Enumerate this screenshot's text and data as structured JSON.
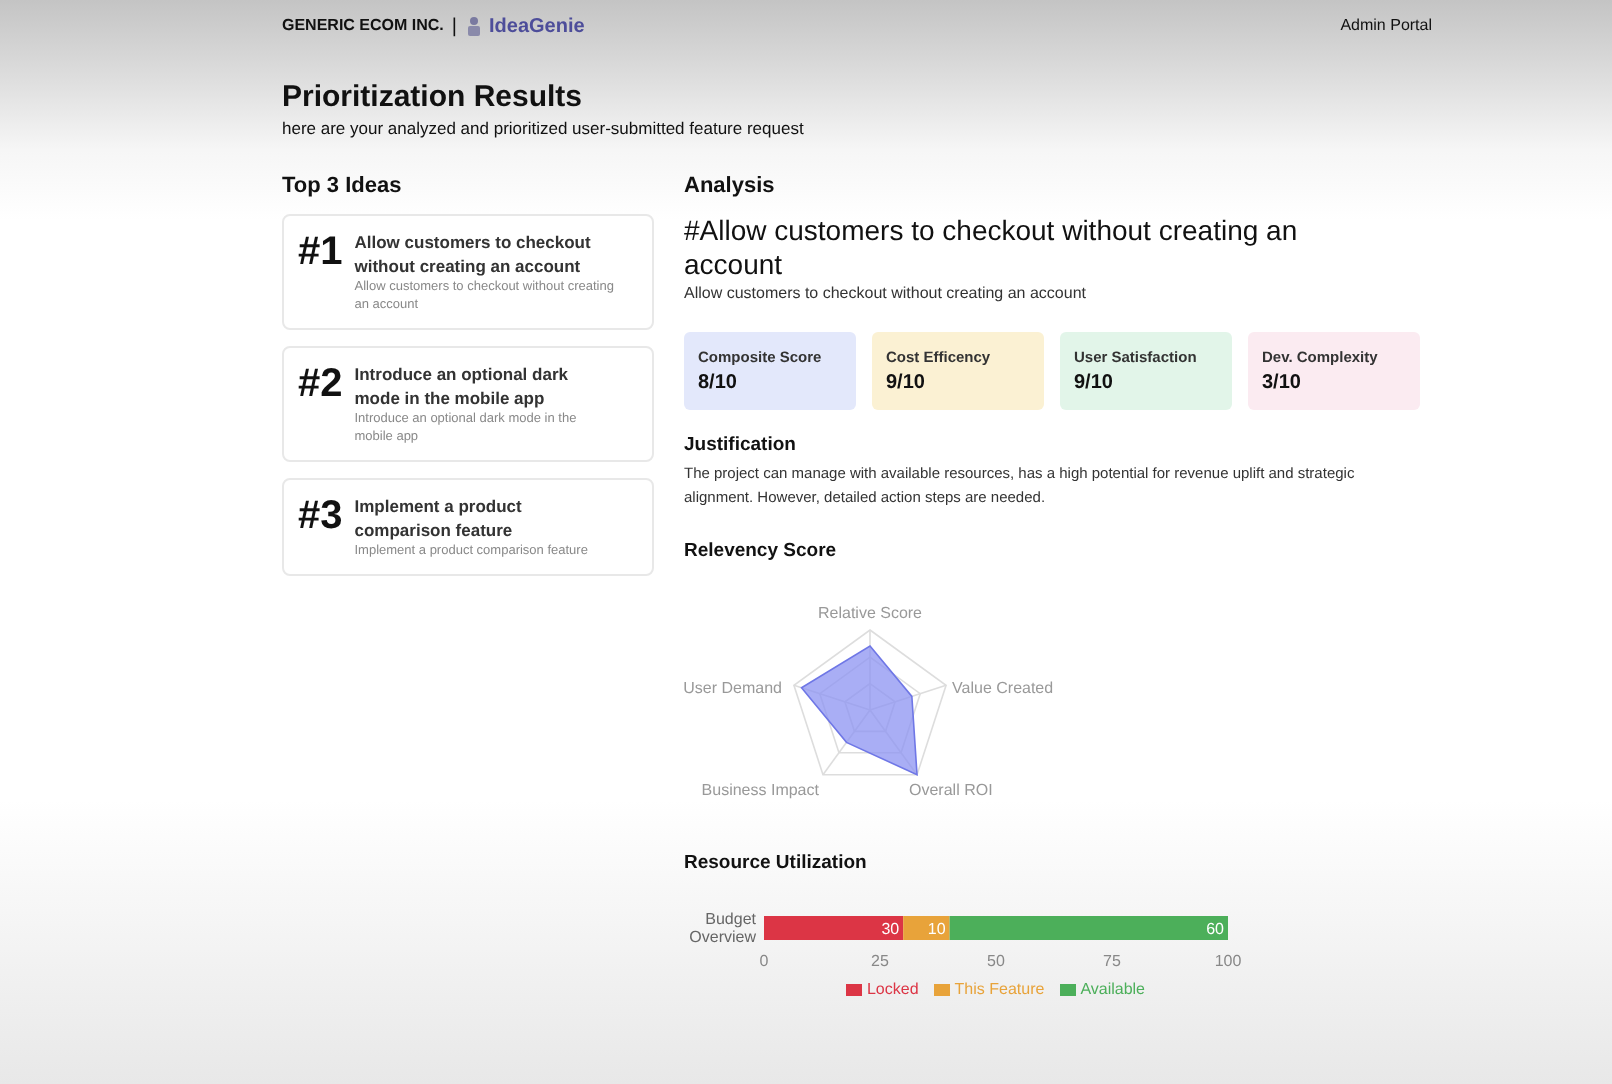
{
  "header": {
    "company": "GENERIC ECOM INC.",
    "separator": "|",
    "app_name": "IdeaGenie",
    "portal": "Admin Portal"
  },
  "page": {
    "title": "Prioritization Results",
    "subtitle": "here are your analyzed and prioritized user-submitted feature request"
  },
  "top_ideas": {
    "heading": "Top 3 Ideas",
    "items": [
      {
        "rank": "#1",
        "title": "Allow customers to checkout without creating an account",
        "description": "Allow customers to checkout without creating an account"
      },
      {
        "rank": "#2",
        "title": "Introduce an optional dark mode in the mobile app",
        "description": "Introduce an optional dark mode in the mobile app"
      },
      {
        "rank": "#3",
        "title": "Implement a product comparison feature",
        "description": "Implement a product comparison feature"
      }
    ]
  },
  "analysis": {
    "heading": "Analysis",
    "title": "#Allow customers to checkout without creating an account",
    "description": "Allow customers to checkout without creating an account",
    "scores": [
      {
        "label": "Composite Score",
        "value": "8/10",
        "color": "#e3e8fb"
      },
      {
        "label": "Cost Efficency",
        "value": "9/10",
        "color": "#fbf1d3"
      },
      {
        "label": "User Satisfaction",
        "value": "9/10",
        "color": "#e2f5e9"
      },
      {
        "label": "Dev. Complexity",
        "value": "3/10",
        "color": "#fbebf1"
      }
    ],
    "justification_heading": "Justification",
    "justification": "The project can manage with available resources, has a high potential for revenue uplift and strategic alignment. However, detailed action steps are needed.",
    "relevancy_heading": "Relevency Score",
    "relevancy_axes": [
      "Relative Score",
      "User Demand",
      "Value Created",
      "Business Impact",
      "Overall ROI"
    ],
    "resource_heading": "Resource Utilization",
    "chart_data": {
      "type": "bar",
      "orientation": "horizontal",
      "stacked": true,
      "data_labels": true,
      "legend": "bottom",
      "categories": [
        "Budget Overview"
      ],
      "xlim": [
        0,
        100
      ],
      "xticks": [
        0,
        25,
        50,
        75,
        100
      ],
      "series": [
        {
          "name": "Locked",
          "color": "#dc3545",
          "values": [
            30
          ]
        },
        {
          "name": "This Feature",
          "color": "#e8a33a",
          "values": [
            10
          ]
        },
        {
          "name": "Available",
          "color": "#4caf5a",
          "values": [
            60
          ]
        }
      ]
    }
  }
}
